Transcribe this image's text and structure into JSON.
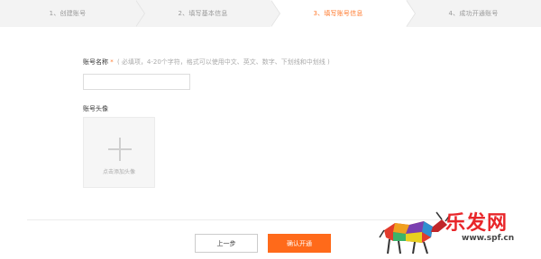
{
  "steps": [
    {
      "label": "1、创建账号"
    },
    {
      "label": "2、填写基本信息"
    },
    {
      "label": "3、填写账号信息",
      "active": true
    },
    {
      "label": "4、成功开通账号"
    }
  ],
  "form": {
    "name_label": "账号名称",
    "name_required": "*",
    "name_hint": "( 必填项，4-20个字符，格式可以使用中文、英文、数字、下划线和中划线 )",
    "name_value": "",
    "avatar_label": "账号头像",
    "avatar_upload_text": "点击添加头像"
  },
  "buttons": {
    "prev": "上一步",
    "confirm": "确认开通"
  },
  "watermark": {
    "logo_text": "乐发网",
    "url": "www.spf.cn"
  },
  "colors": {
    "accent": "#ff6a1a",
    "active_step_text": "#ff7a2e"
  }
}
